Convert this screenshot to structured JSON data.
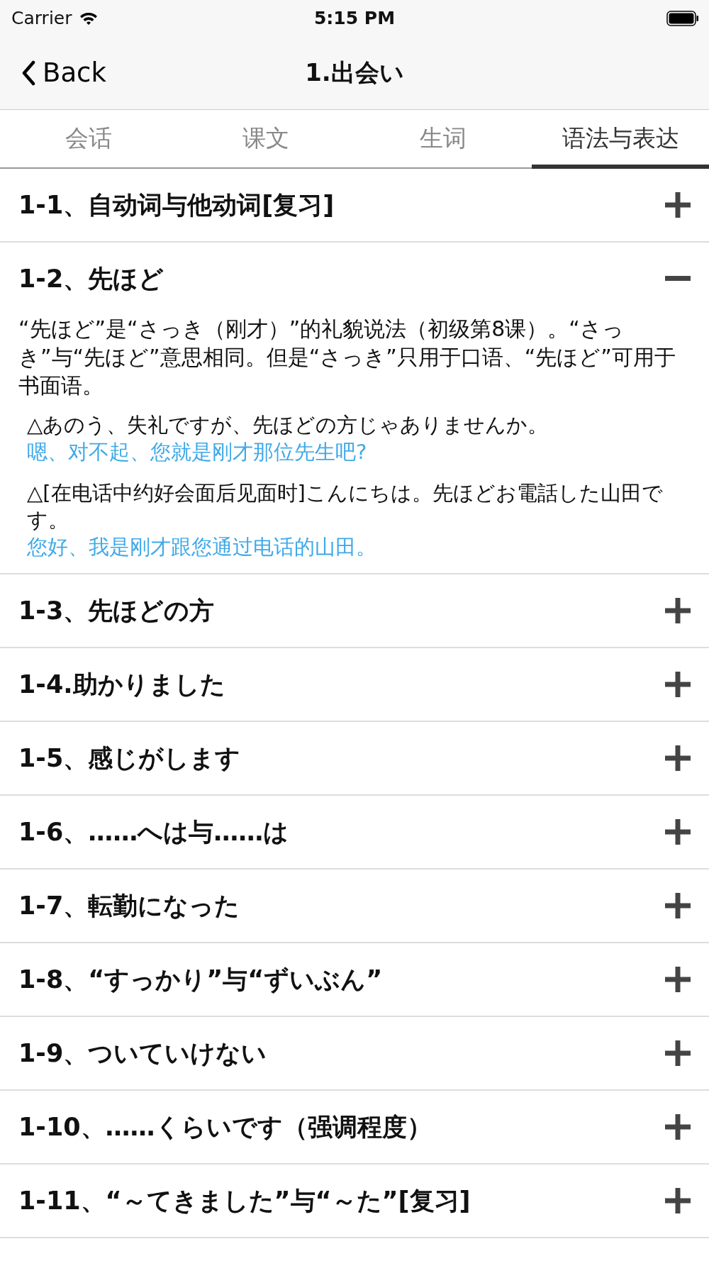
{
  "status_bar": {
    "carrier": "Carrier",
    "time": "5:15 PM"
  },
  "nav": {
    "back": "Back",
    "title": "1.出会い"
  },
  "tabs": [
    {
      "label": "会话",
      "selected": false
    },
    {
      "label": "课文",
      "selected": false
    },
    {
      "label": "生词",
      "selected": false
    },
    {
      "label": "语法与表达",
      "selected": true
    }
  ],
  "items": [
    {
      "title": "1-1、自动词与他动词[复习]",
      "expanded": false
    },
    {
      "title": "1-2、先ほど",
      "expanded": true,
      "explanation": "“先ほど”是“さっき（刚才）”的礼貌说法（初级第8课）。“さっき”与“先ほど”意思相同。但是“さっき”只用于口语、“先ほど”可用于书面语。",
      "examples": [
        {
          "japanese": "△あのう、失礼ですが、先ほどの方じゃありませんか。",
          "chinese": "嗯、对不起、您就是刚才那位先生吧?"
        },
        {
          "japanese": "△[在电话中约好会面后见面时]こんにちは。先ほどお電話した山田です。",
          "chinese": "您好、我是刚才跟您通过电话的山田。"
        }
      ]
    },
    {
      "title": "1-3、先ほどの方",
      "expanded": false
    },
    {
      "title": "1-4.助かりました",
      "expanded": false
    },
    {
      "title": "1-5、感じがします",
      "expanded": false
    },
    {
      "title": "1-6、……へは与……は",
      "expanded": false
    },
    {
      "title": "1-7、転勤になった",
      "expanded": false
    },
    {
      "title": "1-8、“すっかり”与“ずいぶん”",
      "expanded": false
    },
    {
      "title": "1-9、ついていけない",
      "expanded": false
    },
    {
      "title": "1-10、……くらいです（强调程度）",
      "expanded": false
    },
    {
      "title": "1-11、“～てきました”与“～た”[复习]",
      "expanded": false
    }
  ]
}
